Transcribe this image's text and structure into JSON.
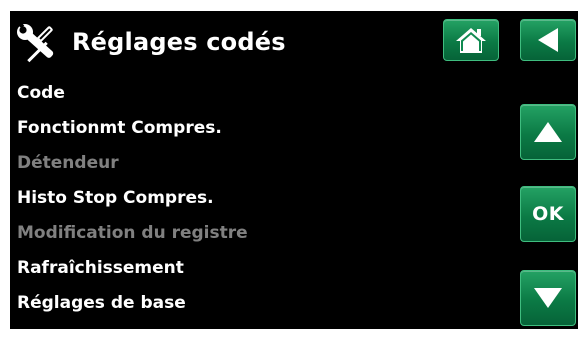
{
  "header": {
    "title": "Réglages codés",
    "icon": "tools-icon",
    "buttons": {
      "home": "home-icon",
      "back": "back-arrow-icon"
    }
  },
  "menu": {
    "items": [
      {
        "label": "Code",
        "enabled": true
      },
      {
        "label": "Fonctionmt Compres.",
        "enabled": true
      },
      {
        "label": "Détendeur",
        "enabled": false
      },
      {
        "label": "Histo Stop Compres.",
        "enabled": true
      },
      {
        "label": "Modification du registre",
        "enabled": false
      },
      {
        "label": "Rafraîchissement",
        "enabled": true
      },
      {
        "label": "Réglages de base",
        "enabled": true
      }
    ]
  },
  "nav": {
    "up_icon": "arrow-up-icon",
    "ok_label": "OK",
    "down_icon": "arrow-down-icon"
  },
  "colors": {
    "background": "#000000",
    "text": "#ffffff",
    "disabled_text": "#808080",
    "button": "#0b7a45",
    "button_border": "#3fbd7f"
  }
}
